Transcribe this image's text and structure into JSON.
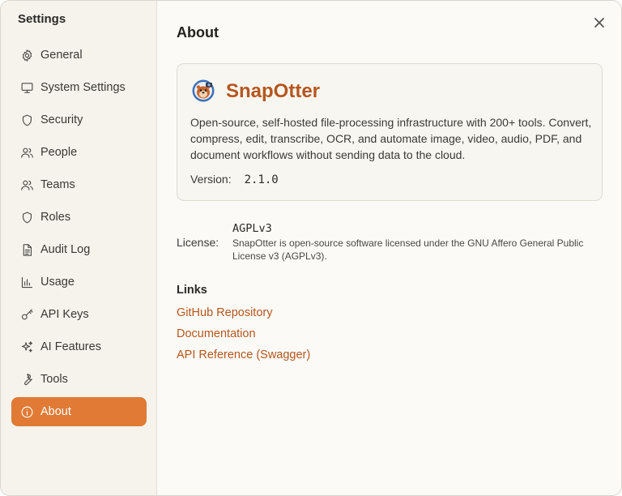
{
  "sidebar": {
    "title": "Settings",
    "items": [
      {
        "label": "General",
        "icon": "gear-icon"
      },
      {
        "label": "System Settings",
        "icon": "monitor-icon"
      },
      {
        "label": "Security",
        "icon": "shield-icon"
      },
      {
        "label": "People",
        "icon": "users-icon"
      },
      {
        "label": "Teams",
        "icon": "users-icon"
      },
      {
        "label": "Roles",
        "icon": "shield-icon"
      },
      {
        "label": "Audit Log",
        "icon": "document-icon"
      },
      {
        "label": "Usage",
        "icon": "bar-chart-icon"
      },
      {
        "label": "API Keys",
        "icon": "key-icon"
      },
      {
        "label": "AI Features",
        "icon": "sparkles-icon"
      },
      {
        "label": "Tools",
        "icon": "wrench-icon"
      },
      {
        "label": "About",
        "icon": "info-icon",
        "active": true
      }
    ]
  },
  "main": {
    "title": "About",
    "app": {
      "name": "SnapOtter",
      "description": "Open-source, self-hosted file-processing infrastructure with 200+ tools. Convert, compress, edit, transcribe, OCR, and automate image, video, audio, PDF, and document workflows without sending data to the cloud.",
      "version_label": "Version:",
      "version": "2.1.0"
    },
    "license": {
      "label": "License:",
      "name": "AGPLv3",
      "description": "SnapOtter is open-source software licensed under the GNU Affero General Public License v3 (AGPLv3)."
    },
    "links": {
      "heading": "Links",
      "items": [
        "GitHub Repository",
        "Documentation",
        "API Reference (Swagger)"
      ]
    }
  },
  "colors": {
    "accent": "#e07a35",
    "link": "#b5561f"
  }
}
